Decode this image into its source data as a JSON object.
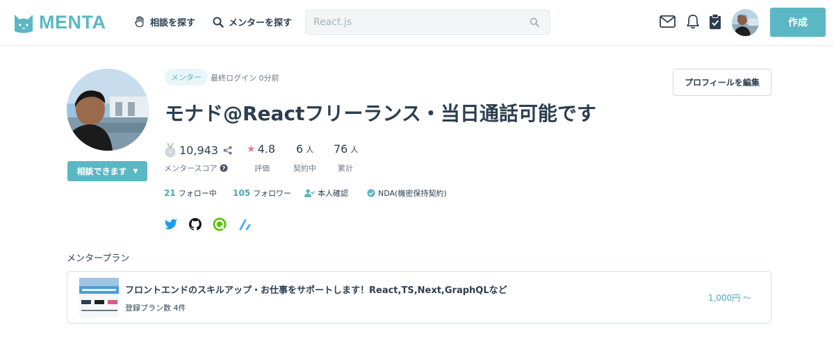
{
  "brand": {
    "name": "MENTA",
    "accent": "#5bb7c4"
  },
  "header": {
    "nav": [
      {
        "label": "相談を探す",
        "icon": "hand-icon"
      },
      {
        "label": "メンターを探す",
        "icon": "search-icon"
      }
    ],
    "search": {
      "placeholder": "React.js"
    },
    "icons": [
      "mail-icon",
      "bell-icon",
      "clipboard-icon"
    ],
    "create_label": "作成"
  },
  "profile": {
    "badge": "メンター",
    "last_login": "最終ログイン 0分前",
    "edit_label": "プロフィールを編集",
    "title": "モナド@Reactフリーランス・当日通話可能です",
    "consult_label": "相談できます",
    "stats": {
      "score": {
        "value": "10,943",
        "label": "メンタースコア"
      },
      "rating": {
        "value": "4.8",
        "label": "評価"
      },
      "contracts": {
        "value": "6",
        "unit": "人",
        "label": "契約中"
      },
      "total": {
        "value": "76",
        "unit": "人",
        "label": "累計"
      }
    },
    "following": {
      "count": "21",
      "label": "フォロー中"
    },
    "followers": {
      "count": "105",
      "label": "フォロワー"
    },
    "identity_label": "本人確認",
    "nda_label": "NDA(機密保持契約)",
    "social": [
      "twitter-icon",
      "github-icon",
      "qiita-icon",
      "zenn-icon"
    ]
  },
  "plans": {
    "section_label": "メンタープラン",
    "items": [
      {
        "title": "フロントエンドのスキルアップ・お仕事をサポートします！React,TS,Next,GraphQLなど",
        "count": "登録プラン数 4件",
        "price": "1,000円 〜"
      }
    ]
  }
}
